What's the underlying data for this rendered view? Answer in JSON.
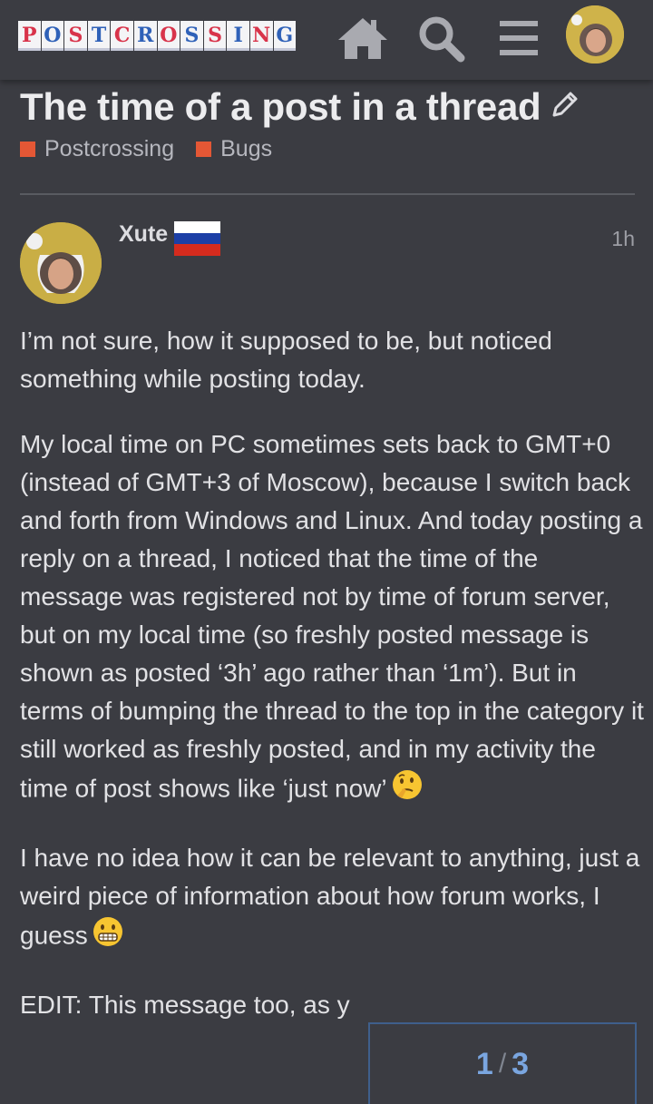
{
  "header": {
    "logo_letters": [
      "P",
      "O",
      "S",
      "T",
      "C",
      "R",
      "O",
      "S",
      "S",
      "I",
      "N",
      "G"
    ],
    "icons": [
      "home-icon",
      "search-icon",
      "hamburger-menu-icon",
      "user-avatar"
    ]
  },
  "topic": {
    "title": "The time of a post in a thread",
    "categories": [
      "Postcrossing",
      "Bugs"
    ],
    "category_color": "#e45735"
  },
  "post": {
    "username": "Xute",
    "time": "1h",
    "paragraphs": [
      "I’m not sure, how it supposed to be, but noticed something while posting today.",
      "My local time on PC sometimes sets back to GMT+0 (instead of GMT+3 of Moscow), because I switch back and forth from Windows and Linux. And today posting a reply on a thread, I noticed that the time of the message was registered not by time of forum server, but on my local time (so freshly posted message is shown as posted ‘3h’ ago rather than ‘1m’). But in terms of bumping the thread to the top in the category it still worked as freshly posted, and in my activity the time of post shows like ‘just now’",
      "I have no idea how it can be relevant to anything, just a weird piece of information about how forum works, I guess",
      "EDIT: This message too, as y"
    ]
  },
  "progress": {
    "current": "1",
    "total": "3"
  }
}
